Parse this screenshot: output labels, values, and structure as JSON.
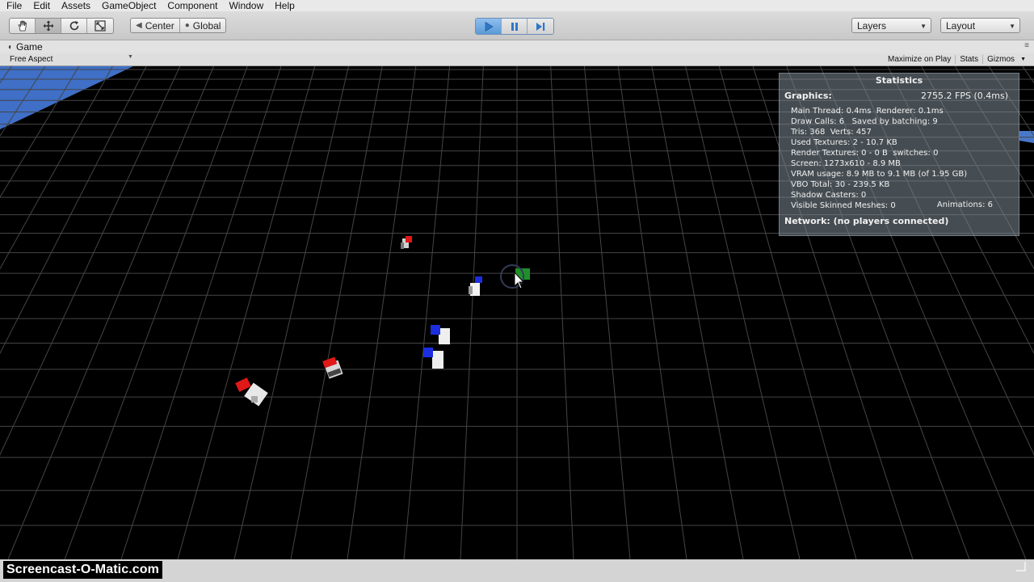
{
  "menubar": {
    "items": [
      "File",
      "Edit",
      "Assets",
      "GameObject",
      "Component",
      "Window",
      "Help"
    ]
  },
  "toolbar": {
    "tools": [
      {
        "name": "hand-tool",
        "icon": "hand-icon"
      },
      {
        "name": "move-tool",
        "icon": "move-arrows-icon"
      },
      {
        "name": "rotate-tool",
        "icon": "rotate-icon"
      },
      {
        "name": "scale-tool",
        "icon": "scale-icon"
      }
    ],
    "pivot_label": "Center",
    "space_label": "Global",
    "playback": [
      "play-icon",
      "pause-icon",
      "step-icon"
    ],
    "layers_label": "Layers",
    "layout_label": "Layout"
  },
  "panel": {
    "tab_label": "Game",
    "aspect_label": "Free Aspect",
    "maximize_label": "Maximize on Play",
    "stats_label": "Stats",
    "gizmos_label": "Gizmos"
  },
  "statistics": {
    "title": "Statistics",
    "graphics_label": "Graphics:",
    "fps": "2755.2 FPS (0.4ms)",
    "lines": [
      "Main Thread: 0.4ms  Renderer: 0.1ms",
      "Draw Calls: 6   Saved by batching: 9",
      "Tris: 368  Verts: 457",
      "Used Textures: 2 - 10.7 KB",
      "Render Textures: 0 - 0 B  switches: 0",
      "Screen: 1273x610 - 8.9 MB",
      "VRAM usage: 8.9 MB to 9.1 MB (of 1.95 GB)",
      "VBO Total: 30 - 239.5 KB",
      "Shadow Casters: 0",
      "Visible Skinned Meshes: 0"
    ],
    "animations": "Animations: 6",
    "network": "Network: (no players connected)"
  },
  "colors": {
    "sky": "#3f6fc6",
    "grid": "#4a4a4a",
    "team_red": "#e01818",
    "team_blue": "#1b2ee0",
    "target_green": "#1f8f2a",
    "play_active": "#5b9ad6"
  },
  "watermark": "Screencast-O-Matic.com"
}
